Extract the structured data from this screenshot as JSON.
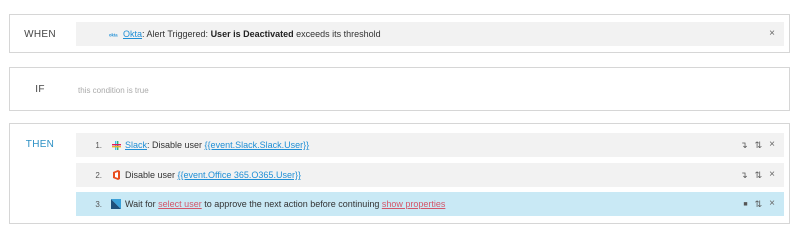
{
  "when": {
    "label": "WHEN",
    "app_link": "Okta",
    "prefix": ": Alert Triggered: ",
    "bold": "User is Deactivated",
    "suffix": " exceeds its threshold",
    "icon": "okta-icon",
    "close": "×"
  },
  "if": {
    "label": "IF",
    "placeholder": "this condition is true"
  },
  "then": {
    "label": "THEN",
    "steps": [
      {
        "num": "1.",
        "icon": "slack-icon",
        "app_link": "Slack",
        "text": ": Disable user ",
        "var": "{{event.Slack.Slack.User}}"
      },
      {
        "num": "2.",
        "icon": "office365-icon",
        "text": "Disable user ",
        "var": "{{event.Office 365.O365.User}}"
      },
      {
        "num": "3.",
        "icon": "approval-icon",
        "text_a": "Wait for ",
        "link_a": "select user",
        "text_b": " to approve the next action before continuing ",
        "link_b": "show properties"
      }
    ],
    "move_icon": "↴",
    "reorder_icon": "⇅",
    "stop_icon": "■",
    "close": "×"
  },
  "colors": {
    "accent": "#2b8fc4",
    "link": "#1f8fd6",
    "warning_link": "#d4566a",
    "active_row": "#c9e9f5"
  }
}
